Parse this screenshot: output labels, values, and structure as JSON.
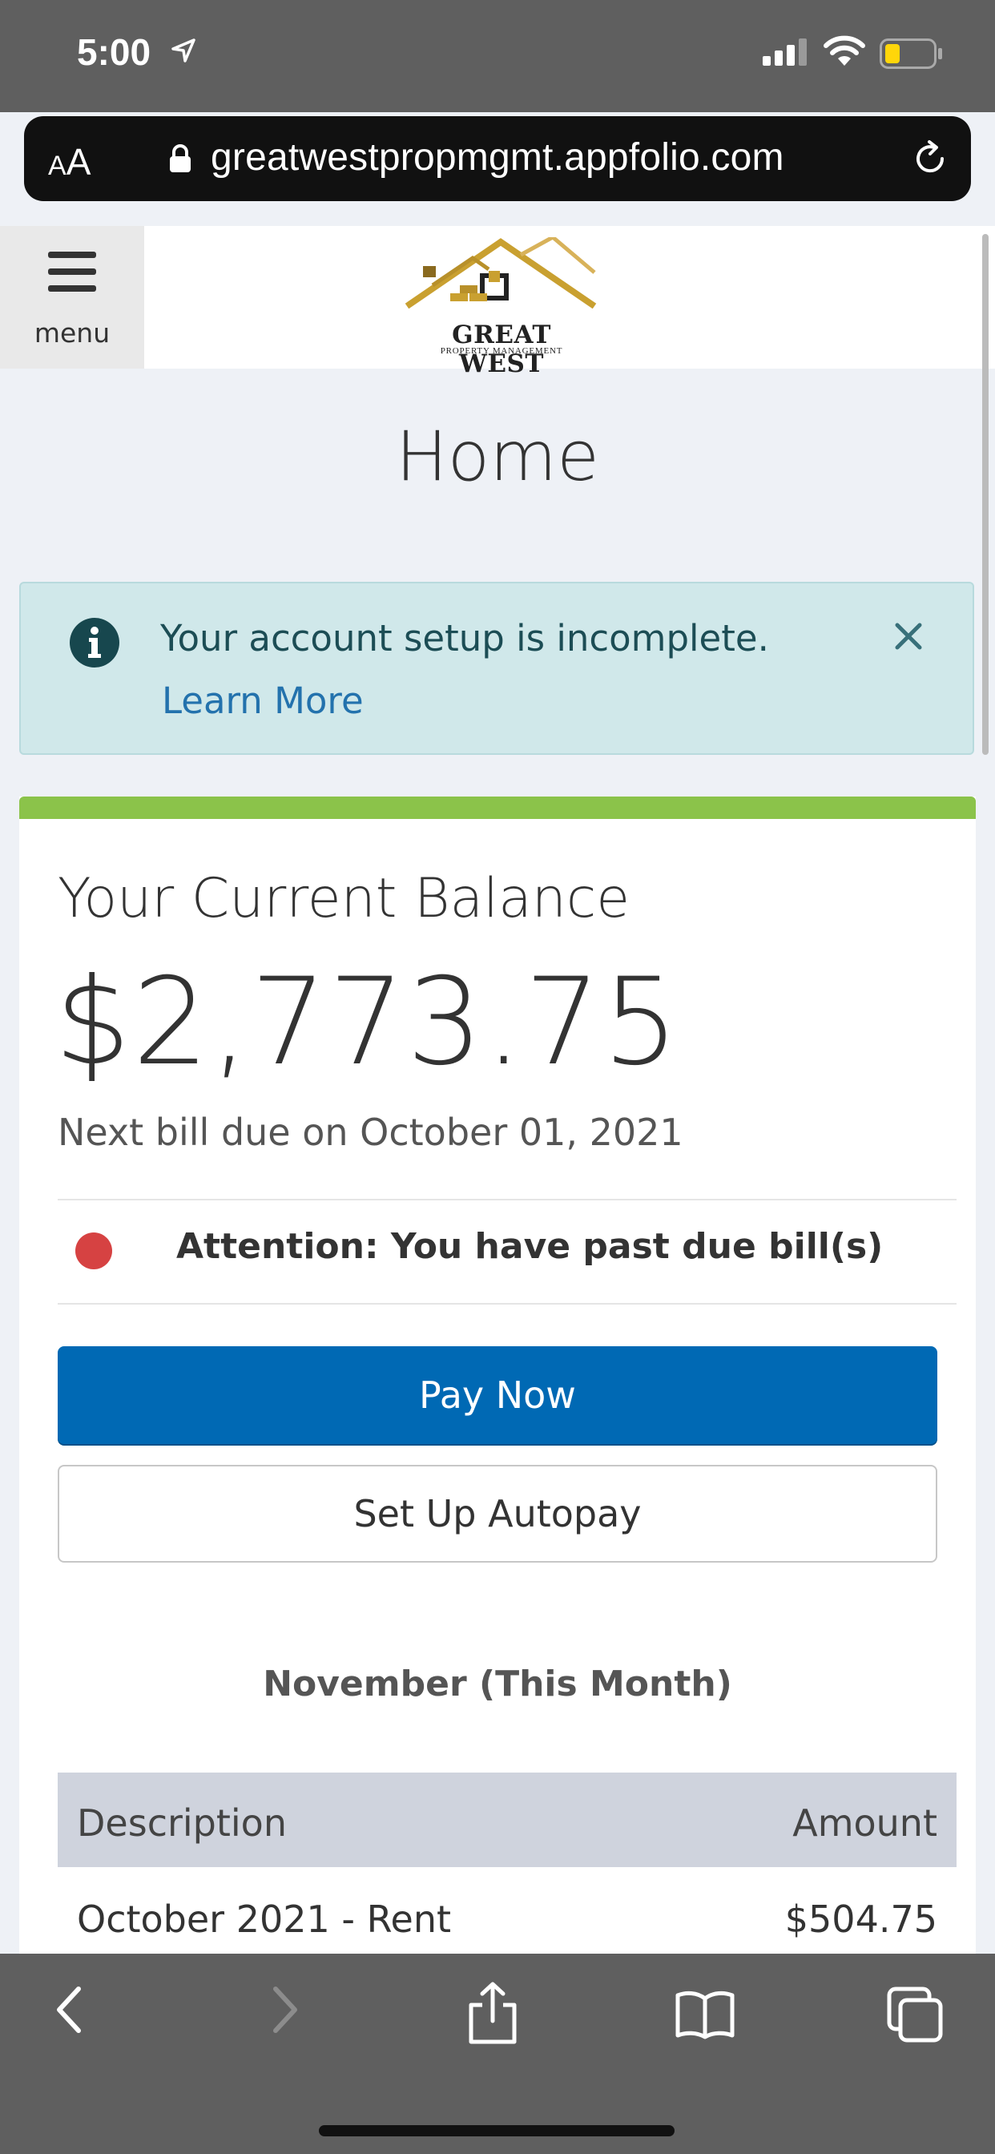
{
  "status_bar": {
    "time": "5:00"
  },
  "browser": {
    "text_size_small": "A",
    "text_size_big": "A",
    "url": "greatwestpropmgmt.appfolio.com"
  },
  "header": {
    "menu_label": "menu",
    "logo_line1": "GREAT WEST",
    "logo_line2": "PROPERTY MANAGEMENT"
  },
  "page": {
    "title": "Home"
  },
  "alert": {
    "message": "Your account setup is incomplete.",
    "link": "Learn More"
  },
  "balance": {
    "title": "Your Current Balance",
    "amount": "$2,773.75",
    "next_bill": "Next bill due on October 01, 2021",
    "attention": "Attention: You have past due bill(s)",
    "pay_now": "Pay Now",
    "setup_autopay": "Set Up Autopay"
  },
  "charges": {
    "period": "November (This Month)",
    "columns": {
      "description": "Description",
      "amount": "Amount"
    },
    "rows": [
      {
        "description": "October 2021 - Rent",
        "amount": "$504.75"
      }
    ]
  },
  "colors": {
    "primary": "#0069b4",
    "accent_green": "#8bc34a",
    "alert_bg": "#d0e8ea",
    "danger": "#d64242"
  }
}
